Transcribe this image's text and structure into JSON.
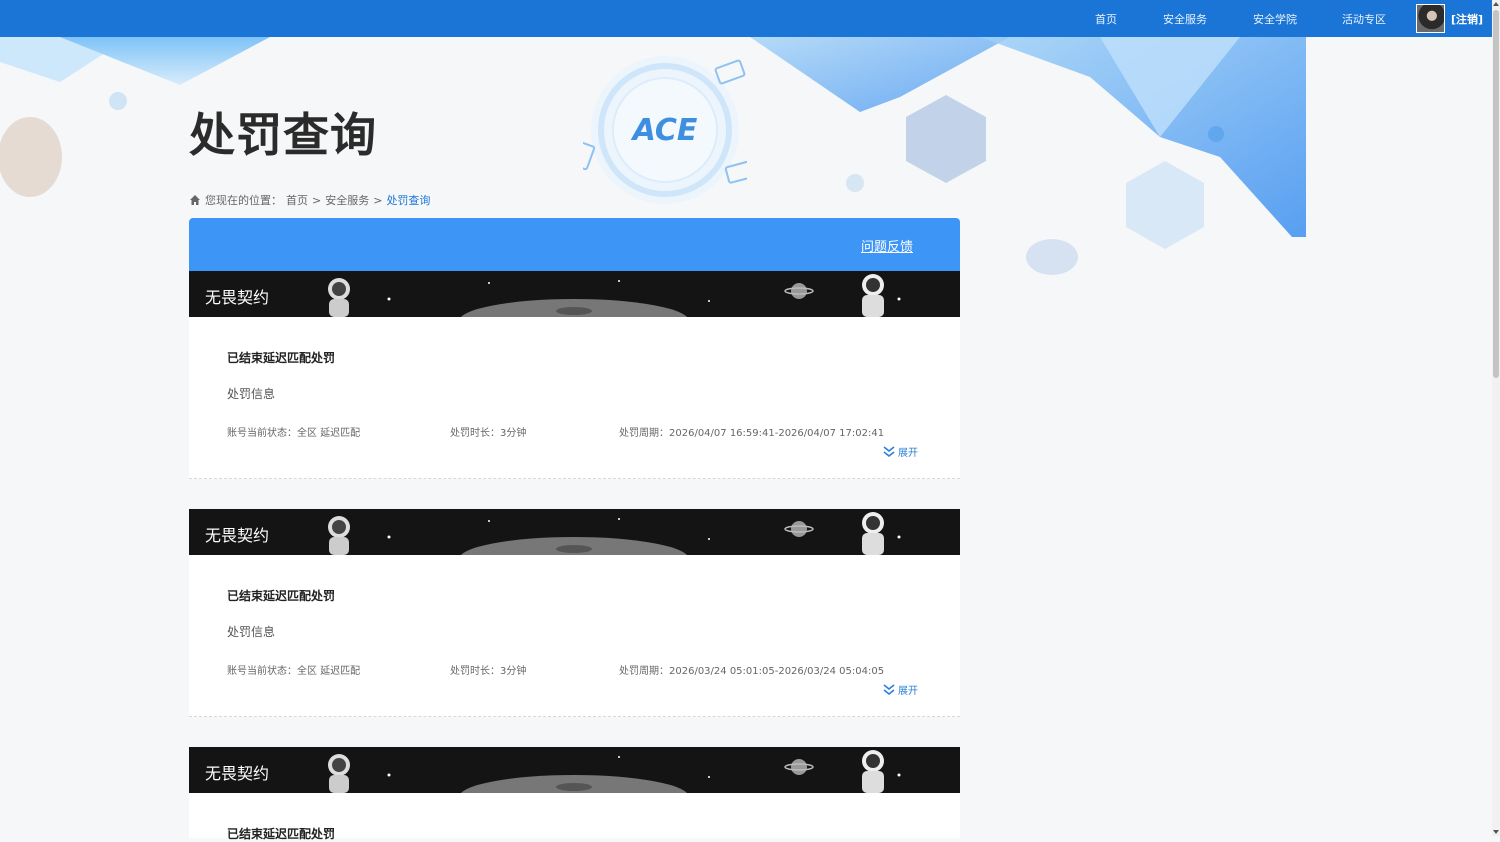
{
  "nav": {
    "links": [
      "首页",
      "安全服务",
      "安全学院",
      "活动专区"
    ],
    "logout": "[注销]"
  },
  "page": {
    "title": "处罚查询",
    "breadcrumb": {
      "prefix": "您现在的位置：",
      "items": [
        "首页",
        "安全服务",
        "处罚查询"
      ],
      "separator": ">"
    }
  },
  "panel": {
    "feedback": "问题反馈",
    "records": [
      {
        "game": "无畏契约",
        "status_title": "已结束延迟匹配处罚",
        "info_title": "处罚信息",
        "account_status": "账号当前状态：全区 延迟匹配",
        "duration": "处罚时长：3分钟",
        "period": "处罚周期：2026/04/07 16:59:41-2026/04/07 17:02:41",
        "expand": "展开"
      },
      {
        "game": "无畏契约",
        "status_title": "已结束延迟匹配处罚",
        "info_title": "处罚信息",
        "account_status": "账号当前状态：全区 延迟匹配",
        "duration": "处罚时长：3分钟",
        "period": "处罚周期：2026/03/24 05:01:05-2026/03/24 05:04:05",
        "expand": "展开"
      },
      {
        "game": "无畏契约",
        "status_title": "已结束延迟匹配处罚",
        "info_title": "",
        "account_status": "",
        "duration": "",
        "period": "",
        "expand": ""
      }
    ]
  },
  "badge": {
    "text": "ACE"
  },
  "colors": {
    "nav": "#1a75d6",
    "header": "#3d96f5",
    "link": "#2b7fd8"
  }
}
